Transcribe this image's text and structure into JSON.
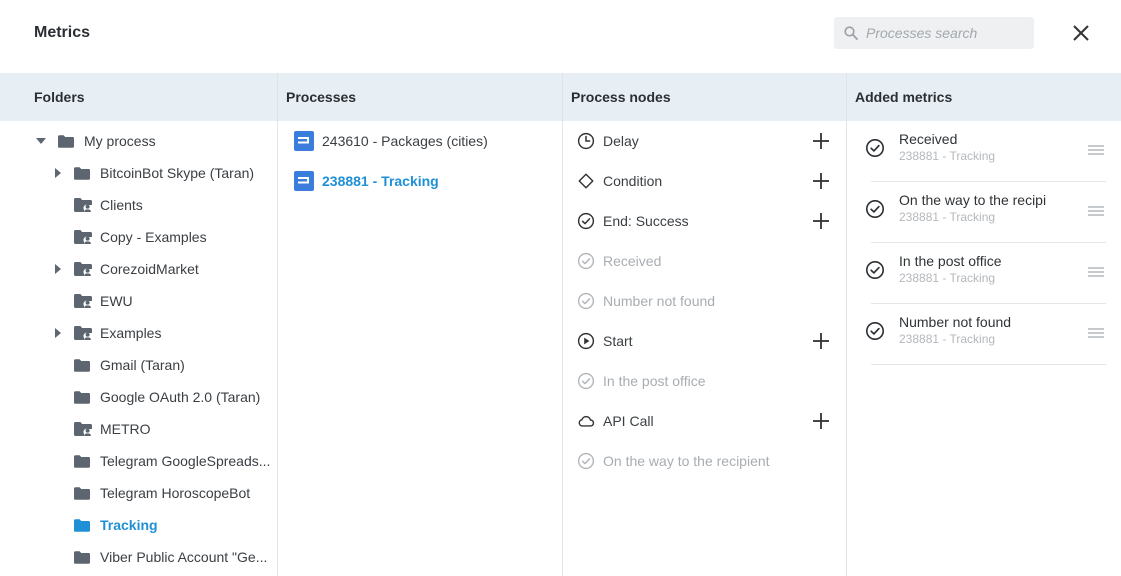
{
  "header": {
    "title": "Metrics",
    "search_placeholder": "Processes search"
  },
  "columns": {
    "folders": "Folders",
    "processes": "Processes",
    "nodes": "Process nodes",
    "metrics": "Added metrics"
  },
  "folders": [
    {
      "label": "My process",
      "icon": "folder-icon"
    },
    {
      "label": "BitcoinBot Skype (Taran)",
      "icon": "folder-icon"
    },
    {
      "label": "Clients",
      "icon": "shared-folder-icon"
    },
    {
      "label": "Copy - Examples",
      "icon": "shared-folder-icon"
    },
    {
      "label": "CorezoidMarket",
      "icon": "shared-folder-icon"
    },
    {
      "label": "EWU",
      "icon": "shared-folder-icon"
    },
    {
      "label": "Examples",
      "icon": "shared-folder-icon"
    },
    {
      "label": "Gmail (Taran)",
      "icon": "folder-icon"
    },
    {
      "label": "Google OAuth 2.0 (Taran)",
      "icon": "folder-icon"
    },
    {
      "label": "METRO",
      "icon": "shared-folder-icon"
    },
    {
      "label": "Telegram GoogleSpreads...",
      "icon": "folder-icon"
    },
    {
      "label": "Telegram HoroscopeBot",
      "icon": "folder-icon"
    },
    {
      "label": "Tracking",
      "icon": "folder-icon"
    },
    {
      "label": "Viber Public Account \"Ge...",
      "icon": "folder-icon"
    }
  ],
  "processes": [
    {
      "label": "243610 - Packages (cities)",
      "icon": "process-icon"
    },
    {
      "label": "238881 - Tracking",
      "icon": "process-icon"
    }
  ],
  "nodes": [
    {
      "label": "Delay",
      "icon": "clock-icon"
    },
    {
      "label": "Condition",
      "icon": "diamond-icon"
    },
    {
      "label": "End: Success",
      "icon": "check-circle-icon"
    },
    {
      "label": "Received",
      "icon": "check-circle-icon"
    },
    {
      "label": "Number not found",
      "icon": "check-circle-icon"
    },
    {
      "label": "Start",
      "icon": "play-circle-icon"
    },
    {
      "label": "In the post office",
      "icon": "check-circle-icon"
    },
    {
      "label": "API Call",
      "icon": "cloud-icon"
    },
    {
      "label": "On the way to the recipient",
      "icon": "check-circle-icon"
    }
  ],
  "metrics": [
    {
      "title": "Received",
      "subtitle": "238881 - Tracking"
    },
    {
      "title": "On the way to the recipi",
      "subtitle": "238881 - Tracking"
    },
    {
      "title": "In the post office",
      "subtitle": "238881 - Tracking"
    },
    {
      "title": "Number not found",
      "subtitle": "238881 - Tracking"
    }
  ],
  "colors": {
    "accent": "#1f8fd6",
    "header_bg": "#e8eff4",
    "process_icon": "#3b7ddd",
    "folder": "#5d6670"
  }
}
